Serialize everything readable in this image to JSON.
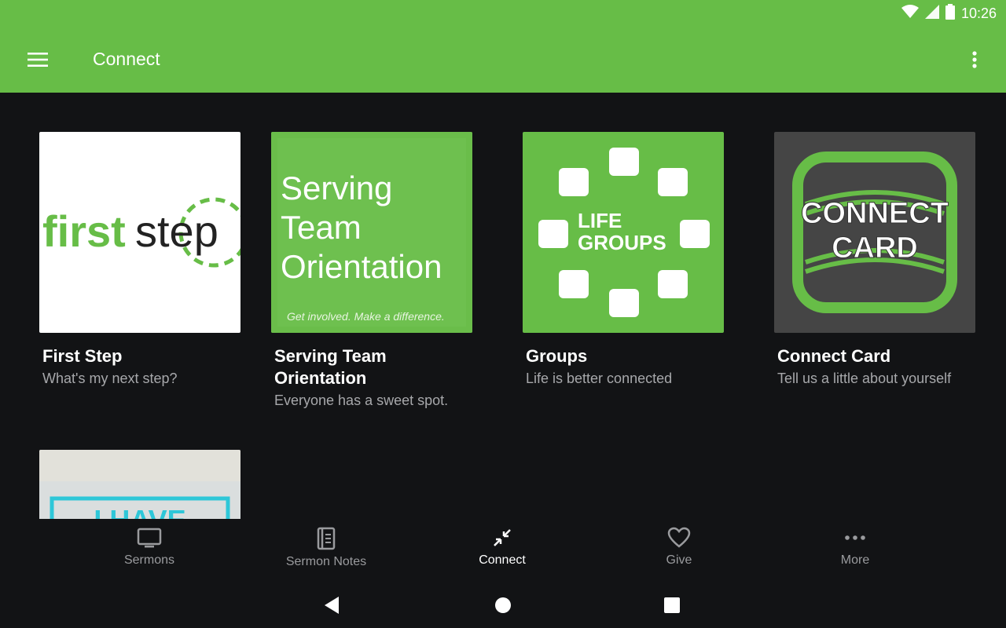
{
  "status_bar": {
    "time": "10:26"
  },
  "app_bar": {
    "title": "Connect"
  },
  "cards": [
    {
      "title": "First Step",
      "subtitle": "What's my next step?",
      "image_text_a": "first",
      "image_text_b": "step"
    },
    {
      "title": "Serving Team Orientation",
      "subtitle": "Everyone has a sweet spot.",
      "image_lines": [
        "Serving",
        "Team",
        "Orientation"
      ],
      "image_tagline": "Get involved. Make a difference."
    },
    {
      "title": "Groups",
      "subtitle": "Life is better connected",
      "image_lines": [
        "LIFE",
        "GROUPS"
      ]
    },
    {
      "title": "Connect Card",
      "subtitle": "Tell us a little about yourself",
      "image_lines": [
        "CONNECT",
        "CARD"
      ]
    }
  ],
  "partial_card": {
    "image_text": "I HAVE"
  },
  "bottom_nav": [
    {
      "label": "Sermons",
      "icon": "tv-icon"
    },
    {
      "label": "Sermon Notes",
      "icon": "notes-icon"
    },
    {
      "label": "Connect",
      "icon": "connect-icon"
    },
    {
      "label": "Give",
      "icon": "heart-icon"
    },
    {
      "label": "More",
      "icon": "more-icon"
    }
  ],
  "active_tab": "Connect",
  "colors": {
    "brand_green": "#67bd47",
    "background": "#121315",
    "text_secondary": "#a7a8ab"
  }
}
